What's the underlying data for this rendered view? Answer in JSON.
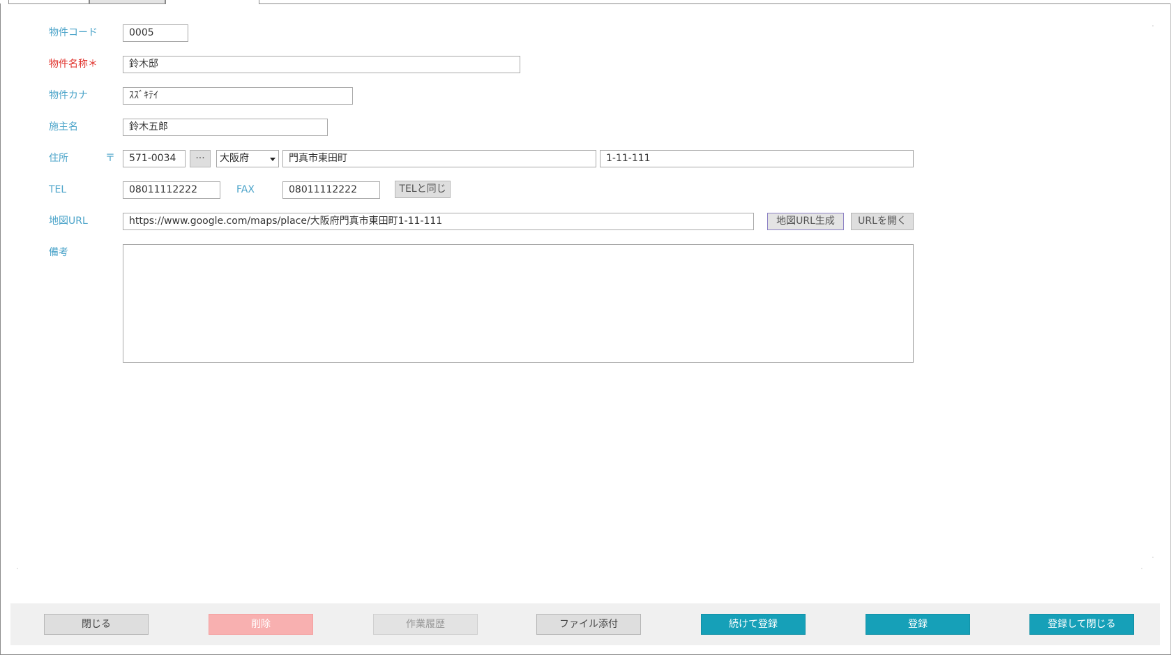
{
  "form": {
    "code_label": "物件コード",
    "code_value": "0005",
    "name_label": "物件名称＊",
    "name_value": "鈴木邸",
    "kana_label": "物件カナ",
    "kana_value": "ｽｽﾞｷﾃｲ",
    "owner_label": "施主名",
    "owner_value": "鈴木五郎",
    "address_label": "住所",
    "postal_mark": "〒",
    "postal_value": "571-0034",
    "lookup_label": "···",
    "prefecture_value": "大阪府",
    "city_value": "門真市東田町",
    "street_value": "1-11-111",
    "tel_label": "TEL",
    "tel_value": "08011112222",
    "fax_label": "FAX",
    "fax_value": "08011112222",
    "same_as_tel_label": "TELと同じ",
    "map_url_label": "地図URL",
    "map_url_value": "https://www.google.com/maps/place/大阪府門真市東田町1-11-111",
    "generate_map_url_label": "地図URL生成",
    "open_url_label": "URLを開く",
    "notes_label": "備考",
    "notes_value": ""
  },
  "footer": {
    "close_label": "閉じる",
    "delete_label": "削除",
    "history_label": "作業履歴",
    "attach_label": "ファイル添付",
    "register_continue_label": "続けて登録",
    "register_label": "登録",
    "register_close_label": "登録して閉じる"
  },
  "colors": {
    "label": "#4aa3c9",
    "required": "#e0302a",
    "primary": "#16a0b8",
    "danger": "#f8b0b0"
  }
}
